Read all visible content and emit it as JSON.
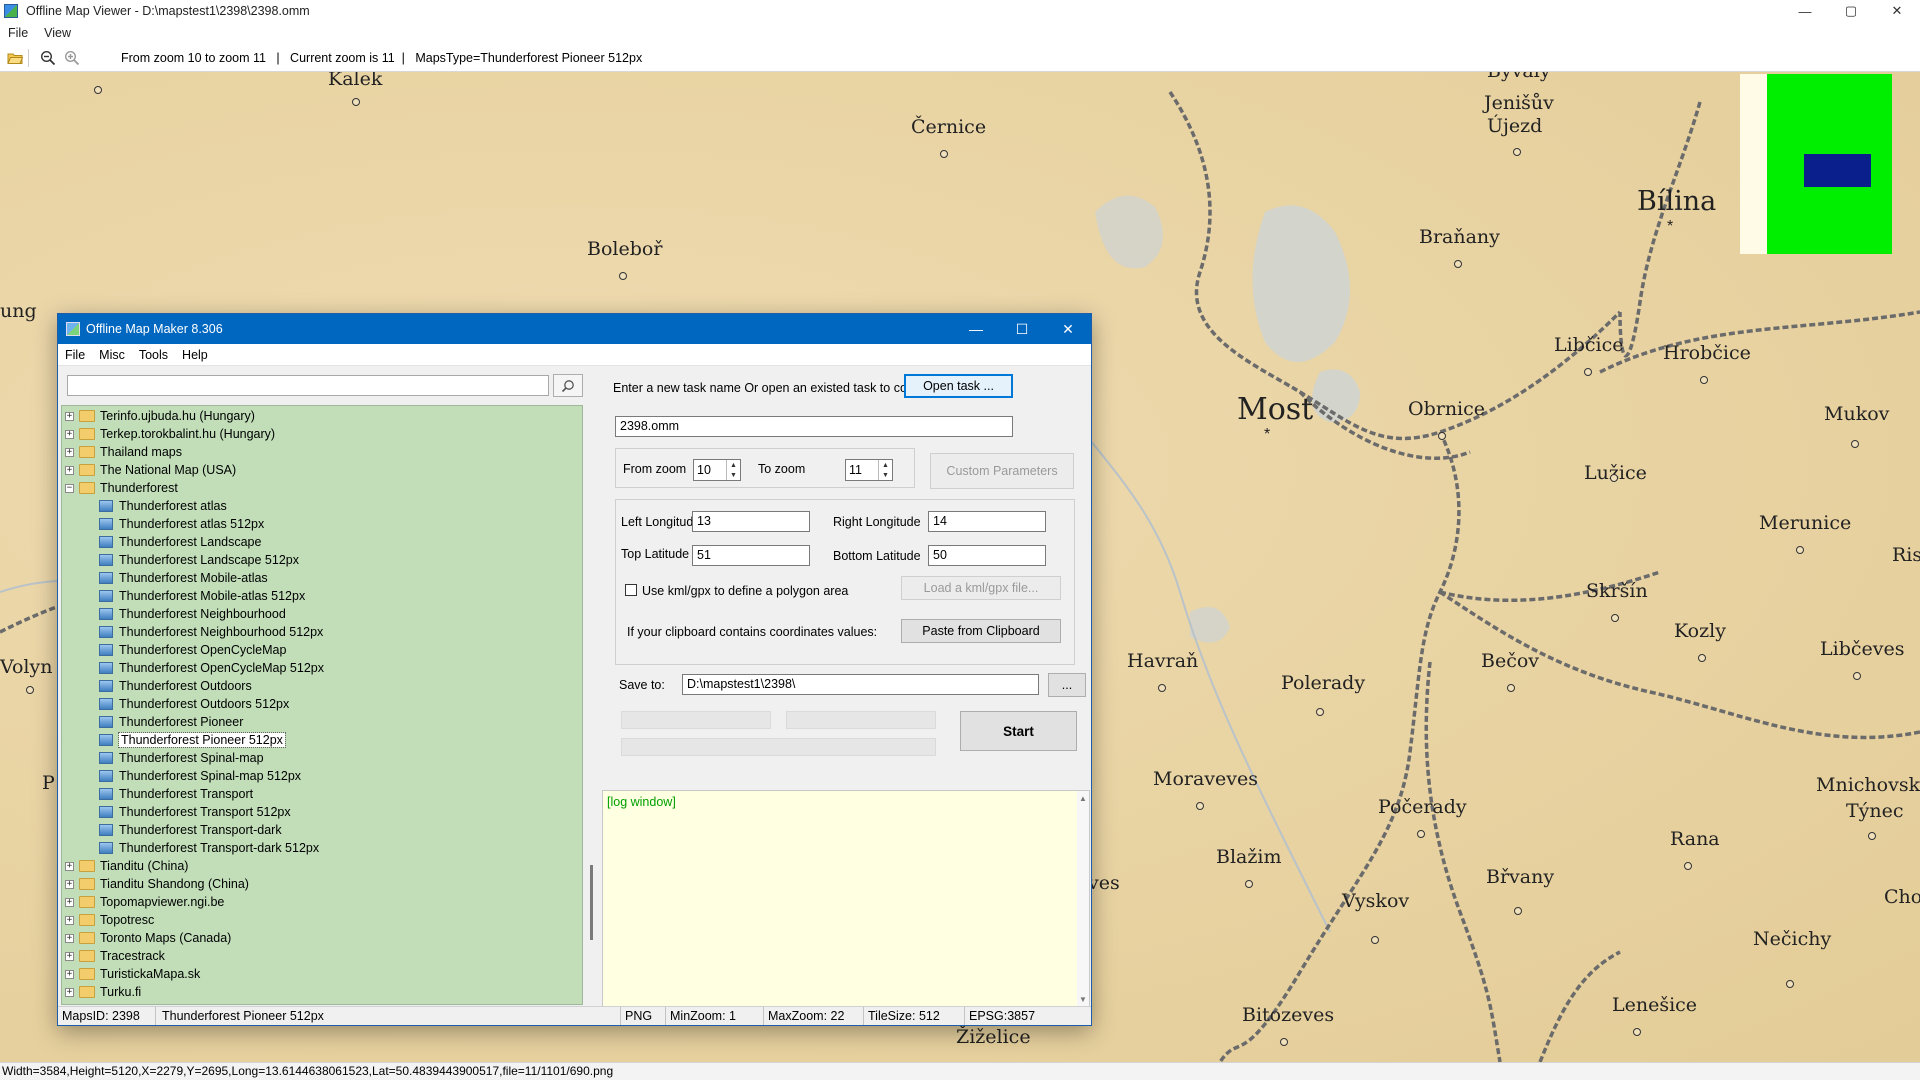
{
  "viewer": {
    "title": "Offline Map Viewer - D:\\mapstest1\\2398\\2398.omm",
    "menu": [
      "File",
      "View"
    ],
    "toolbar_info": "From zoom 10 to zoom 11   |   Current zoom is 11  |   MapsType=Thunderforest Pioneer 512px",
    "status": "Width=3584,Height=5120,X=2279,Y=2695,Long=13.6144638061523,Lat=50.4839443900517,file=11/1101/690.png",
    "controls": {
      "minimize": "—",
      "maximize": "▢",
      "close": "✕"
    }
  },
  "map": {
    "places": [
      {
        "name": "Kalek"
      },
      {
        "name": "Černice"
      },
      {
        "name": "Byvaly"
      },
      {
        "name": "Jenišův"
      },
      {
        "name": "Újezd"
      },
      {
        "name": "Bílina"
      },
      {
        "name": "Boleboř"
      },
      {
        "name": "Braňany"
      },
      {
        "name": "Most"
      },
      {
        "name": "Obrnice"
      },
      {
        "name": "Libčice"
      },
      {
        "name": "Hrobčice"
      },
      {
        "name": "Mukov"
      },
      {
        "name": "Lužice"
      },
      {
        "name": "Merunice"
      },
      {
        "name": "Skršín"
      },
      {
        "name": "Kozly"
      },
      {
        "name": "Libčeves"
      },
      {
        "name": "Havraň"
      },
      {
        "name": "Bečov"
      },
      {
        "name": "Polerady"
      },
      {
        "name": "Moraveves"
      },
      {
        "name": "Počerady"
      },
      {
        "name": "Mnichovský"
      },
      {
        "name": "Týnec"
      },
      {
        "name": "Rana"
      },
      {
        "name": "Blažim"
      },
      {
        "name": "Břvany"
      },
      {
        "name": "Vyskov"
      },
      {
        "name": "Nečichy"
      },
      {
        "name": "Bitozeves"
      },
      {
        "name": "Lenešice"
      },
      {
        "name": "Žiželice"
      },
      {
        "name": "ung"
      },
      {
        "name": "Volyn"
      },
      {
        "name": "P"
      },
      {
        "name": "ves"
      },
      {
        "name": "Ris"
      },
      {
        "name": "Cho"
      }
    ]
  },
  "dialog": {
    "title": "Offline Map Maker 8.306",
    "menu": [
      "File",
      "Misc",
      "Tools",
      "Help"
    ],
    "controls": {
      "minimize": "—",
      "maximize": "☐",
      "close": "✕"
    },
    "search_value": "",
    "tree": [
      {
        "label": "Terinfo.ujbuda.hu (Hungary)",
        "type": "folder"
      },
      {
        "label": "Terkep.torokbalint.hu (Hungary)",
        "type": "folder"
      },
      {
        "label": "Thailand maps",
        "type": "folder"
      },
      {
        "label": "The National Map (USA)",
        "type": "folder"
      },
      {
        "label": "Thunderforest",
        "type": "folder-open"
      },
      {
        "label": "Thunderforest atlas",
        "type": "map"
      },
      {
        "label": "Thunderforest atlas 512px",
        "type": "map"
      },
      {
        "label": "Thunderforest Landscape",
        "type": "map"
      },
      {
        "label": "Thunderforest Landscape 512px",
        "type": "map"
      },
      {
        "label": "Thunderforest Mobile-atlas",
        "type": "map"
      },
      {
        "label": "Thunderforest Mobile-atlas 512px",
        "type": "map"
      },
      {
        "label": "Thunderforest Neighbourhood",
        "type": "map"
      },
      {
        "label": "Thunderforest Neighbourhood 512px",
        "type": "map"
      },
      {
        "label": "Thunderforest OpenCycleMap",
        "type": "map"
      },
      {
        "label": "Thunderforest OpenCycleMap 512px",
        "type": "map"
      },
      {
        "label": "Thunderforest Outdoors",
        "type": "map"
      },
      {
        "label": "Thunderforest Outdoors 512px",
        "type": "map"
      },
      {
        "label": "Thunderforest Pioneer",
        "type": "map"
      },
      {
        "label": "Thunderforest Pioneer 512px",
        "type": "map",
        "selected": true
      },
      {
        "label": "Thunderforest Spinal-map",
        "type": "map"
      },
      {
        "label": "Thunderforest Spinal-map 512px",
        "type": "map"
      },
      {
        "label": "Thunderforest Transport",
        "type": "map"
      },
      {
        "label": "Thunderforest Transport 512px",
        "type": "map"
      },
      {
        "label": "Thunderforest Transport-dark",
        "type": "map"
      },
      {
        "label": "Thunderforest Transport-dark 512px",
        "type": "map"
      },
      {
        "label": "Tianditu (China)",
        "type": "folder"
      },
      {
        "label": "Tianditu Shandong (China)",
        "type": "folder"
      },
      {
        "label": "Topomapviewer.ngi.be",
        "type": "folder"
      },
      {
        "label": "Topotresc",
        "type": "folder"
      },
      {
        "label": "Toronto Maps (Canada)",
        "type": "folder"
      },
      {
        "label": "Tracestrack",
        "type": "folder"
      },
      {
        "label": "TuristickaMapa.sk",
        "type": "folder"
      },
      {
        "label": "Turku.fi",
        "type": "folder"
      }
    ],
    "task_prompt": "Enter a new task name Or open an existed task to continue:",
    "open_task_label": "Open task ...",
    "task_name": "2398.omm",
    "from_zoom_label": "From zoom",
    "from_zoom": "10",
    "to_zoom_label": "To zoom",
    "to_zoom": "11",
    "custom_params_label": "Custom Parameters",
    "left_lon_label": "Left Longitude",
    "left_lon": "13",
    "right_lon_label": "Right Longitude",
    "right_lon": "14",
    "top_lat_label": "Top Latitude",
    "top_lat": "51",
    "bottom_lat_label": "Bottom Latitude",
    "bottom_lat": "50",
    "kml_label": "Use kml/gpx to define a polygon area",
    "load_kml_label": "Load a kml/gpx file...",
    "clipboard_prompt": "If your clipboard contains coordinates values:",
    "paste_label": "Paste from Clipboard",
    "save_to_label": "Save to:",
    "save_to": "D:\\mapstest1\\2398\\",
    "browse_label": "...",
    "start_label": "Start",
    "log_text": "[log window]",
    "status": {
      "maps_id": "MapsID: 2398",
      "map_name": "Thunderforest Pioneer 512px",
      "format": "PNG",
      "min_zoom": "MinZoom: 1",
      "max_zoom": "MaxZoom: 22",
      "tile_size": "TileSize: 512",
      "epsg": "EPSG:3857"
    }
  }
}
